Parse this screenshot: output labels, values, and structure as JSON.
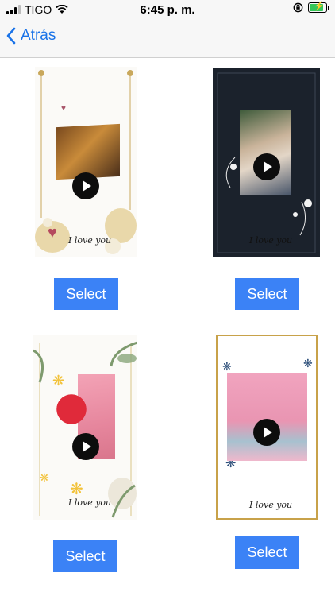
{
  "status_bar": {
    "carrier": "TIGO",
    "time": "6:45 p. m."
  },
  "nav": {
    "back_label": "Atrás"
  },
  "templates": [
    {
      "caption": "I love you",
      "select_label": "Select"
    },
    {
      "caption": "I love you",
      "select_label": "Select"
    },
    {
      "caption": "I love you",
      "select_label": "Select"
    },
    {
      "caption": "I love you",
      "select_label": "Select"
    }
  ],
  "colors": {
    "accent": "#1a73e8",
    "button": "#3b82f6",
    "battery": "#34c759"
  }
}
